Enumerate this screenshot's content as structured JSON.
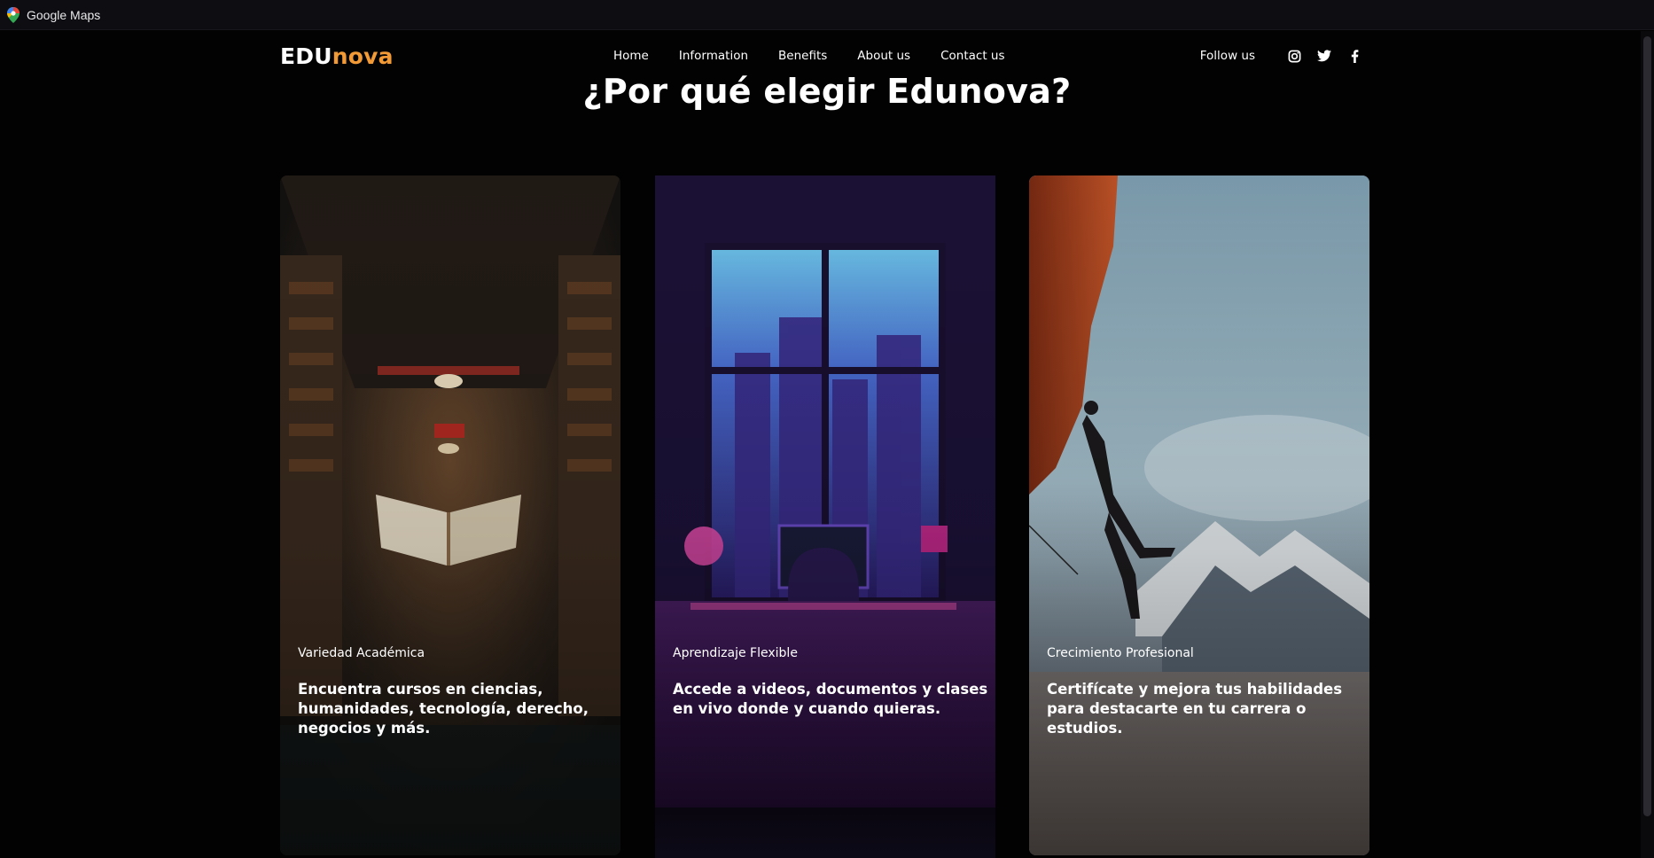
{
  "window": {
    "app_title": "Google Maps"
  },
  "nav": {
    "logo_part1": "EDU",
    "logo_part2": "nova",
    "links": [
      "Home",
      "Information",
      "Benefits",
      "About us",
      "Contact us"
    ],
    "follow_label": "Follow us",
    "social_icons": [
      "instagram-icon",
      "twitter-icon",
      "facebook-icon"
    ]
  },
  "hero": {
    "title": "¿Por qué elegir Edunova?"
  },
  "cards": [
    {
      "category": "Variedad Académica",
      "description": "Encuentra cursos en ciencias, humanidades, tecnología, derecho, negocios y más."
    },
    {
      "category": "Aprendizaje Flexible",
      "description": "Accede a videos, documentos y clases en vivo donde y cuando quieras."
    },
    {
      "category": "Crecimiento Profesional",
      "description": "Certifícate y mejora tus habilidades para destacarte en tu carrera o estudios."
    }
  ],
  "colors": {
    "accent": "#f29a35",
    "background": "#020203"
  }
}
